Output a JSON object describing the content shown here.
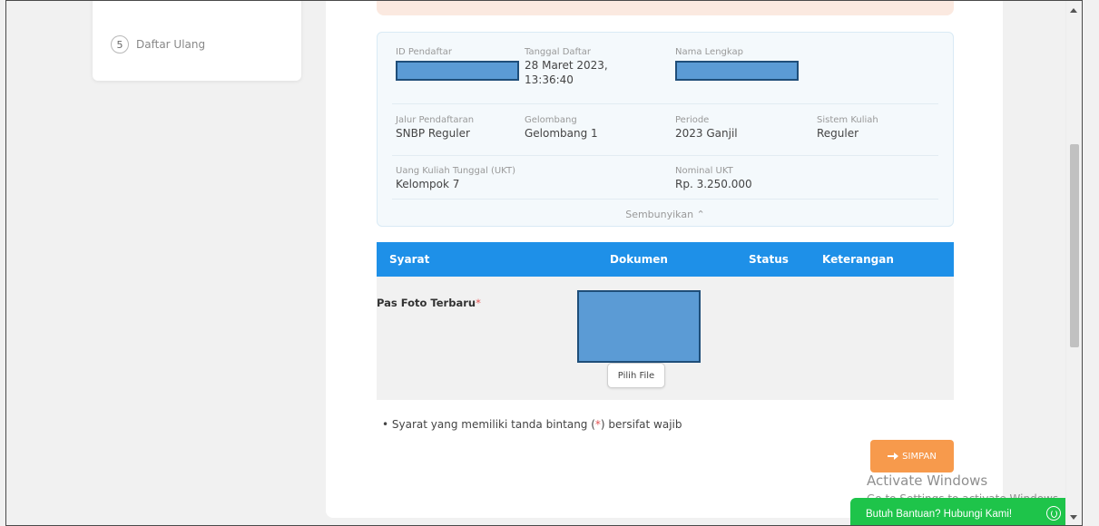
{
  "sidebar": {
    "step_number": "5",
    "step_label": "Daftar Ulang"
  },
  "info": {
    "id_pendaftar_label": "ID Pendaftar",
    "tanggal_daftar_label": "Tanggal Daftar",
    "tanggal_daftar_value_line1": "28 Maret 2023,",
    "tanggal_daftar_value_line2": "13:36:40",
    "nama_lengkap_label": "Nama Lengkap",
    "jalur_label": "Jalur Pendaftaran",
    "jalur_value": "SNBP Reguler",
    "gelombang_label": "Gelombang",
    "gelombang_value": "Gelombang 1",
    "periode_label": "Periode",
    "periode_value": "2023 Ganjil",
    "sistem_label": "Sistem Kuliah",
    "sistem_value": "Reguler",
    "ukt_label": "Uang Kuliah Tunggal (UKT)",
    "ukt_value": "Kelompok 7",
    "nominal_label": "Nominal UKT",
    "nominal_value": "Rp. 3.250.000",
    "toggle_label": "Sembunyikan ⌃"
  },
  "table": {
    "headers": [
      "Syarat",
      "Dokumen",
      "Status",
      "Keterangan"
    ],
    "row": {
      "requirement": "Pas Foto Terbaru",
      "required_mark": "*",
      "file_button": "Pilih File"
    }
  },
  "note": {
    "bullet": "•",
    "text_before": "Syarat yang memiliki tanda bintang (",
    "star": "*",
    "text_after": ") bersifat wajib"
  },
  "save_button": {
    "icon": "arrow-right-icon",
    "label": "SIMPAN"
  },
  "watermark": {
    "title": "Activate Windows",
    "subtitle": "Go to Settings to activate Windows."
  },
  "help_button": {
    "label": "Butuh Bantuan? Hubungi Kami!",
    "icon": "whatsapp-icon"
  },
  "colors": {
    "header_blue": "#1e90e8",
    "save_orange": "#f79a4c",
    "help_green": "#1ec44a",
    "required_red": "#e55353"
  }
}
